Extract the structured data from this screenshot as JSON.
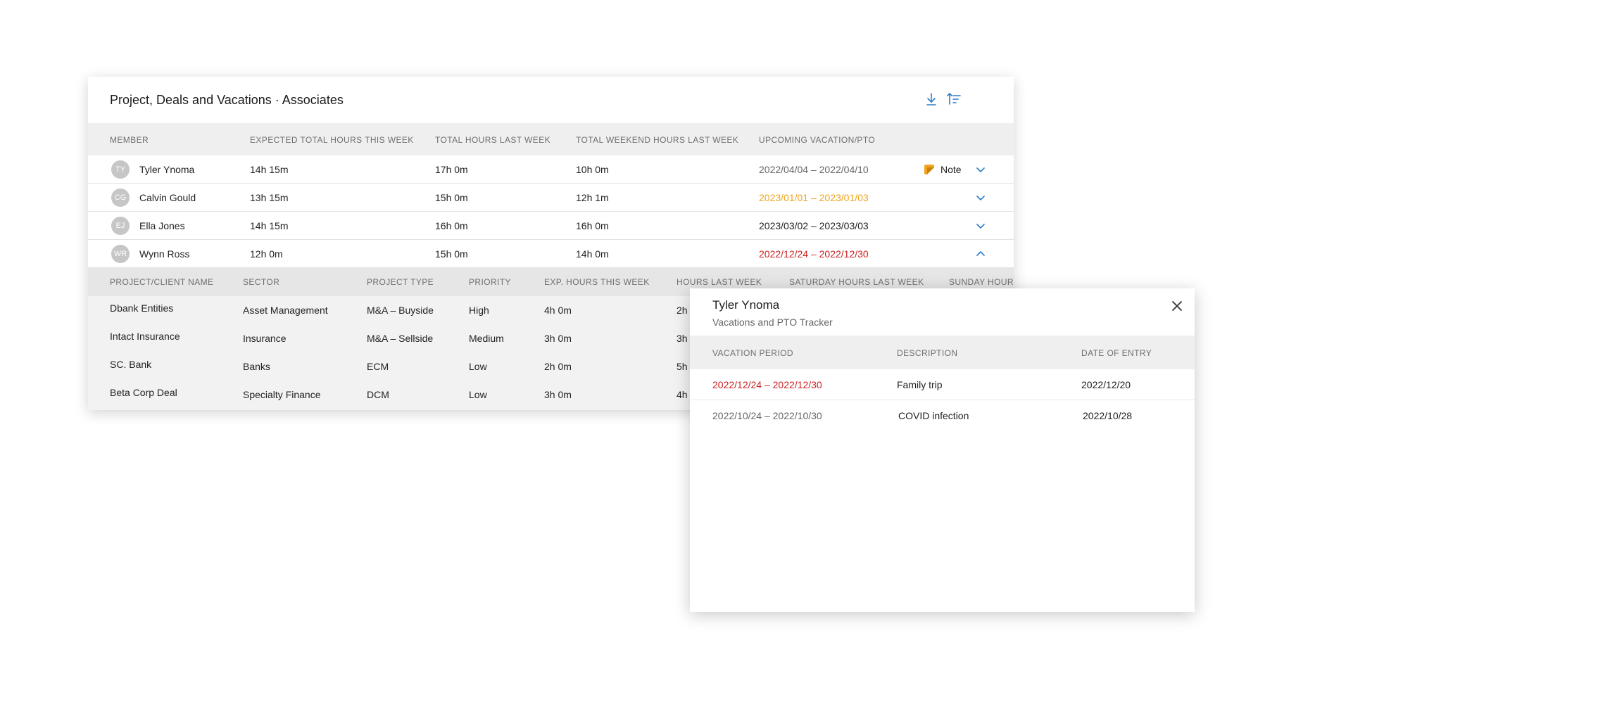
{
  "card": {
    "title": "Project, Deals and Vacations · Associates",
    "download_icon": "download-icon",
    "sort_icon": "sort-filter-icon"
  },
  "columns": {
    "member": "MEMBER",
    "expected": "EXPECTED TOTAL HOURS THIS WEEK",
    "total_last": "TOTAL HOURS LAST WEEK",
    "weekend_last": "TOTAL WEEKEND HOURS LAST WEEK",
    "vacation": "UPCOMING VACATION/PTO"
  },
  "colors": {
    "accent": "#2a7dc9",
    "orange": "#f0a31c",
    "red": "#cc1f1f",
    "grey_text": "#666666"
  },
  "members": [
    {
      "initials": "TY",
      "name": "Tyler Ynoma",
      "expected": "14h 15m",
      "total_last": "17h 0m",
      "weekend_last": "10h 0m",
      "vacation": "2022/04/04 – 2022/04/10",
      "vacation_color": "#666666",
      "note": "Note",
      "expanded": false
    },
    {
      "initials": "CG",
      "name": "Calvin Gould",
      "expected": "13h 15m",
      "total_last": "15h 0m",
      "weekend_last": "12h 1m",
      "vacation": "2023/01/01 – 2023/01/03",
      "vacation_color": "#f0a31c",
      "note": "",
      "expanded": false
    },
    {
      "initials": "EJ",
      "name": "Ella Jones",
      "expected": "14h 15m",
      "total_last": "16h 0m",
      "weekend_last": "16h 0m",
      "vacation": "2023/03/02 – 2023/03/03",
      "vacation_color": "#222222",
      "note": "",
      "expanded": false
    },
    {
      "initials": "WR",
      "name": "Wynn Ross",
      "expected": "12h 0m",
      "total_last": "15h 0m",
      "weekend_last": "14h 0m",
      "vacation": "2022/12/24 – 2022/12/30",
      "vacation_color": "#cc1f1f",
      "note": "",
      "expanded": true
    }
  ],
  "sub_columns": {
    "project": "PROJECT/CLIENT NAME",
    "sector": "SECTOR",
    "type": "PROJECT TYPE",
    "priority": "PRIORITY",
    "exp_hours": "EXP. HOURS THIS WEEK",
    "hours_last": "HOURS LAST WEEK",
    "sat_hours": "SATURDAY HOURS LAST WEEK",
    "sun_hours": "SUNDAY HOURS"
  },
  "projects": [
    {
      "name": "Dbank Entities",
      "sector": "Asset Management",
      "type": "M&A – Buyside",
      "priority": "High",
      "exp_hours": "4h 0m",
      "hours_last": "2h"
    },
    {
      "name": "Intact Insurance",
      "sector": "Insurance",
      "type": "M&A – Sellside",
      "priority": "Medium",
      "exp_hours": "3h 0m",
      "hours_last": "3h"
    },
    {
      "name": "SC. Bank",
      "sector": "Banks",
      "type": "ECM",
      "priority": "Low",
      "exp_hours": "2h 0m",
      "hours_last": "5h"
    },
    {
      "name": "Beta Corp Deal",
      "sector": "Specialty Finance",
      "type": "DCM",
      "priority": "Low",
      "exp_hours": "3h 0m",
      "hours_last": "4h"
    }
  ],
  "popup": {
    "title": "Tyler Ynoma",
    "subtitle": "Vacations and PTO Tracker",
    "close_icon": "close-icon",
    "columns": {
      "period": "VACATION PERIOD",
      "description": "DESCRIPTION",
      "date": "DATE OF ENTRY"
    },
    "rows": [
      {
        "period": "2022/12/24 – 2022/12/30",
        "period_color": "#cc1f1f",
        "description": "Family trip",
        "date": "2022/12/20"
      },
      {
        "period": "2022/10/24 – 2022/10/30",
        "period_color": "#666666",
        "description": "COVID infection",
        "date": "2022/10/28"
      }
    ]
  }
}
